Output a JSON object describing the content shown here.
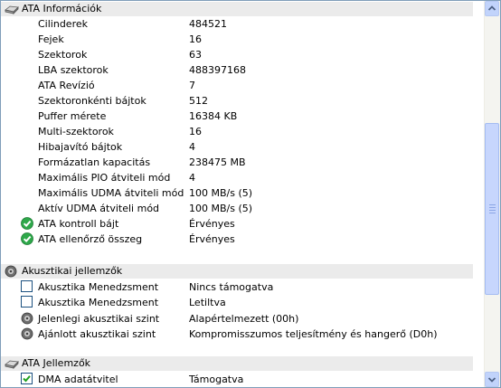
{
  "groups": {
    "ata_info": {
      "title": "ATA Információk",
      "icon": "drive-icon"
    },
    "acoustic": {
      "title": "Akusztikai jellemzők",
      "icon": "speaker-icon"
    },
    "ata_features": {
      "title": "ATA Jellemzők",
      "icon": "drive-icon"
    }
  },
  "ata_rows": [
    {
      "label": "Cilinderek",
      "value": "484521"
    },
    {
      "label": "Fejek",
      "value": "16"
    },
    {
      "label": "Szektorok",
      "value": "63"
    },
    {
      "label": "LBA szektorok",
      "value": "488397168"
    },
    {
      "label": "ATA Revízió",
      "value": "7"
    },
    {
      "label": "Szektoronkénti bájtok",
      "value": "512"
    },
    {
      "label": "Puffer mérete",
      "value": "16384 KB"
    },
    {
      "label": "Multi-szektorok",
      "value": "16"
    },
    {
      "label": "Hibajavító bájtok",
      "value": "4"
    },
    {
      "label": "Formázatlan kapacitás",
      "value": "238475 MB"
    },
    {
      "label": "Maximális PIO átviteli mód",
      "value": "4"
    },
    {
      "label": "Maximális UDMA átviteli mód",
      "value": "100 MB/s (5)"
    },
    {
      "label": "Aktív UDMA átviteli mód",
      "value": "100 MB/s (5)"
    },
    {
      "label": "ATA kontroll bájt",
      "value": "Érvényes",
      "icon": "check-icon"
    },
    {
      "label": "ATA ellenőrző összeg",
      "value": "Érvényes",
      "icon": "check-icon"
    }
  ],
  "acoustic_rows": [
    {
      "label": "Akusztika Menedzsment",
      "value": "Nincs támogatva",
      "icon": "checkbox-icon",
      "checked": false
    },
    {
      "label": "Akusztika Menedzsment",
      "value": "Letiltva",
      "icon": "checkbox-icon",
      "checked": false
    },
    {
      "label": "Jelenlegi akusztikai szint",
      "value": "Alapértelmezett (00h)",
      "icon": "speaker-icon"
    },
    {
      "label": "Ajánlott akusztikai szint",
      "value": "Kompromisszumos teljesítmény és hangerő (D0h)",
      "icon": "speaker-icon"
    }
  ],
  "feature_rows": [
    {
      "label": "DMA adatátvitel",
      "value": "Támogatva",
      "icon": "checkbox-icon",
      "checked": true
    }
  ],
  "colors": {
    "group_bg": "#ebebeb",
    "check_green": "#2ea84a",
    "scrollbar_thumb": "#c7d6fd",
    "border": "#7f9db9"
  }
}
